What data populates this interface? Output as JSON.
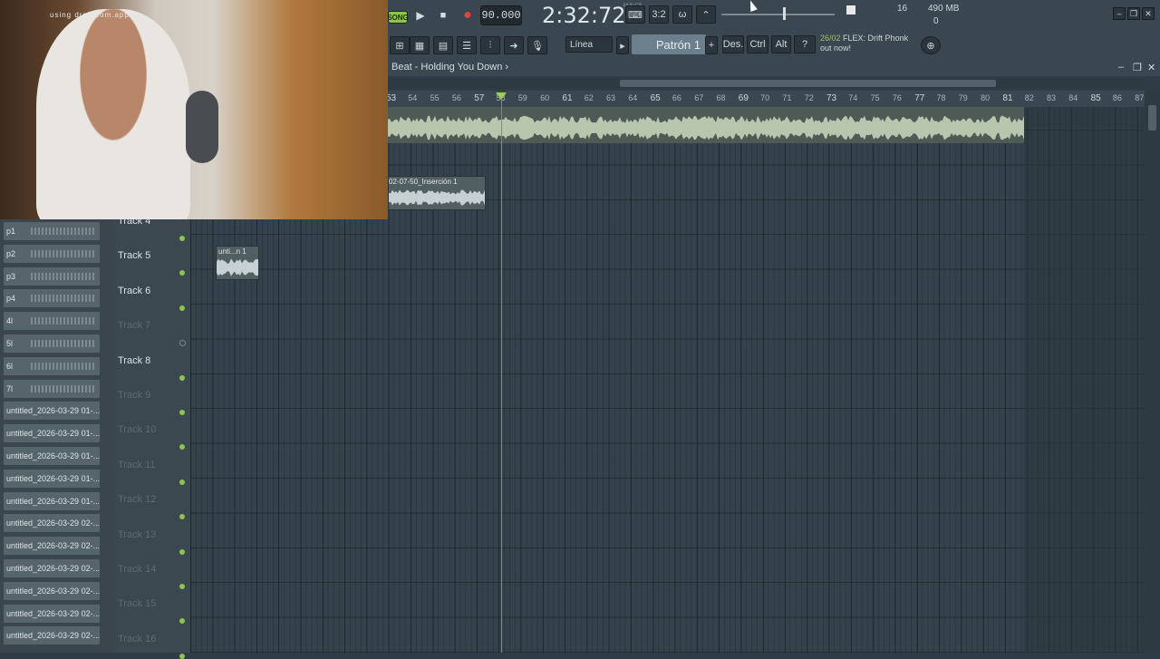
{
  "transport": {
    "song_label": "SONG",
    "tempo": "90.000",
    "time": "2:32:72",
    "time_unit": "M:S:CS"
  },
  "meters": {
    "voices": "16",
    "memory": "490 MB",
    "zero": "0"
  },
  "toolbar2": {
    "snap": "Línea",
    "pattern": "Patrón 1",
    "des": "Des.",
    "ctrl": "Ctrl",
    "alt": "Alt"
  },
  "news": {
    "date": "26/02",
    "line1": "FLEX: Drift Phonk",
    "line2": "out now!"
  },
  "playlist": {
    "title": "Beat - Holding You Down ›"
  },
  "timeline": {
    "bars": [
      "53",
      "54",
      "55",
      "56",
      "57",
      "58",
      "59",
      "60",
      "61",
      "62",
      "63",
      "64",
      "65",
      "66",
      "67",
      "68",
      "69",
      "70",
      "71",
      "72",
      "73",
      "74",
      "75",
      "76",
      "77",
      "78",
      "79",
      "80",
      "81",
      "82",
      "83",
      "84",
      "85",
      "86",
      "87"
    ]
  },
  "clips": {
    "insert": "02-07-50_Inserción 1",
    "unti": "unti...n 1"
  },
  "webcam": {
    "caption": "using drnidcom.app"
  },
  "browser_items": [
    "p1",
    "p2",
    "p3",
    "p4",
    "4l",
    "5l",
    "6l",
    "7l",
    "untitled_2026-03-29 01-...",
    "untitled_2026-03-29 01-...",
    "untitled_2026-03-29 01-...",
    "untitled_2026-03-29 01-...",
    "untitled_2026-03-29 01-...",
    "untitled_2026-03-29 02-...",
    "untitled_2026-03-29 02-...",
    "untitled_2026-03-29 02-...",
    "untitled_2026-03-29 02-...",
    "untitled_2026-03-29 02-...",
    "untitled_2026-03-29 02-..."
  ],
  "tracks": [
    {
      "name": "Track 4",
      "active": true
    },
    {
      "name": "Track 5",
      "active": true
    },
    {
      "name": "Track 6",
      "active": true
    },
    {
      "name": "Track 7",
      "active": false
    },
    {
      "name": "Track 8",
      "active": true
    },
    {
      "name": "Track 9",
      "active": false
    },
    {
      "name": "Track 10",
      "active": false
    },
    {
      "name": "Track 11",
      "active": false
    },
    {
      "name": "Track 12",
      "active": false
    },
    {
      "name": "Track 13",
      "active": false
    },
    {
      "name": "Track 14",
      "active": false
    },
    {
      "name": "Track 15",
      "active": false
    },
    {
      "name": "Track 16",
      "active": false
    }
  ],
  "colors": {
    "accent_green": "#8ec34e",
    "record_red": "#e0453f",
    "background": "#2f3c45"
  }
}
